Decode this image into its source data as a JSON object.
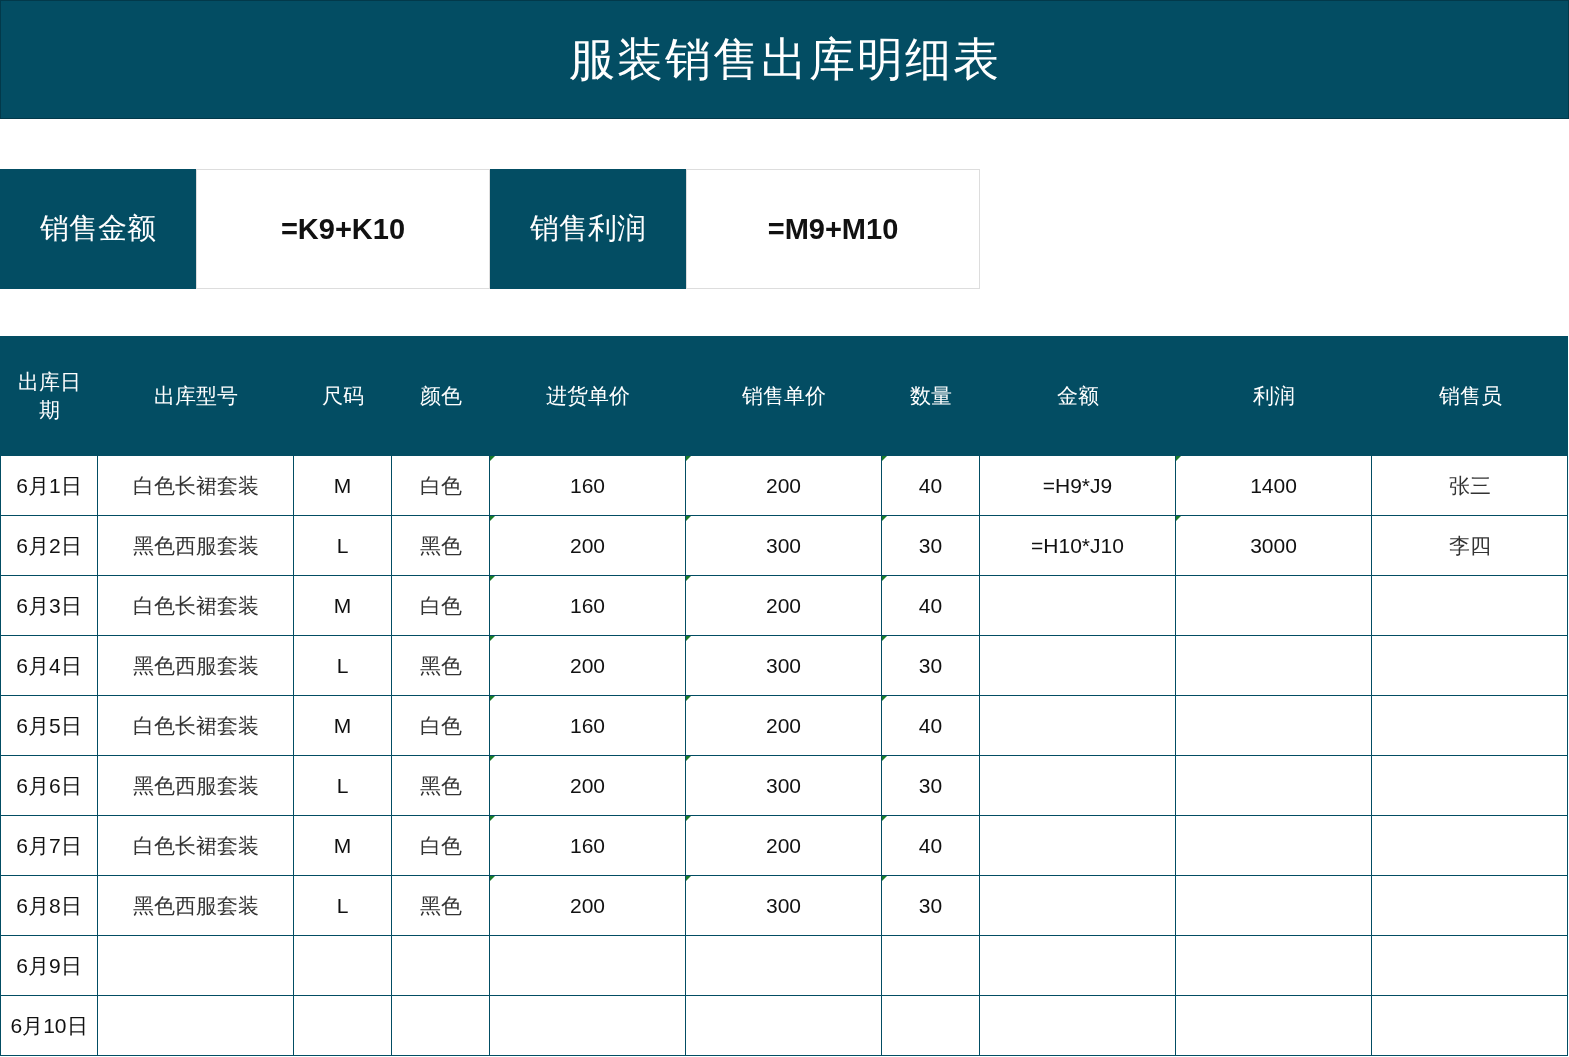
{
  "title": "服装销售出库明细表",
  "summary": [
    {
      "label": "销售金额",
      "value": "=K9+K10"
    },
    {
      "label": "销售利润",
      "value": "=M9+M10"
    }
  ],
  "table": {
    "columns": [
      "出库日期",
      "出库型号",
      "尺码",
      "颜色",
      "进货单价",
      "销售单价",
      "数量",
      "金额",
      "利润",
      "销售员"
    ],
    "rows": [
      [
        {
          "text": "6月1日",
          "flagged": false
        },
        {
          "text": "白色长裙套装",
          "flagged": false
        },
        {
          "text": "M",
          "flagged": false
        },
        {
          "text": "白色",
          "flagged": false
        },
        {
          "text": "160",
          "flagged": true
        },
        {
          "text": "200",
          "flagged": true
        },
        {
          "text": "40",
          "flagged": true
        },
        {
          "text": "=H9*J9",
          "flagged": false
        },
        {
          "text": "1400",
          "flagged": true
        },
        {
          "text": "张三",
          "flagged": false
        }
      ],
      [
        {
          "text": "6月2日",
          "flagged": false
        },
        {
          "text": "黑色西服套装",
          "flagged": false
        },
        {
          "text": "L",
          "flagged": false
        },
        {
          "text": "黑色",
          "flagged": false
        },
        {
          "text": "200",
          "flagged": true
        },
        {
          "text": "300",
          "flagged": true
        },
        {
          "text": "30",
          "flagged": true
        },
        {
          "text": "=H10*J10",
          "flagged": false
        },
        {
          "text": "3000",
          "flagged": true
        },
        {
          "text": "李四",
          "flagged": false
        }
      ],
      [
        {
          "text": "6月3日",
          "flagged": false
        },
        {
          "text": "白色长裙套装",
          "flagged": false
        },
        {
          "text": "M",
          "flagged": false
        },
        {
          "text": "白色",
          "flagged": false
        },
        {
          "text": "160",
          "flagged": true
        },
        {
          "text": "200",
          "flagged": true
        },
        {
          "text": "40",
          "flagged": true
        }
      ],
      [
        {
          "text": "6月4日",
          "flagged": false
        },
        {
          "text": "黑色西服套装",
          "flagged": false
        },
        {
          "text": "L",
          "flagged": false
        },
        {
          "text": "黑色",
          "flagged": false
        },
        {
          "text": "200",
          "flagged": true
        },
        {
          "text": "300",
          "flagged": true
        },
        {
          "text": "30",
          "flagged": true
        }
      ],
      [
        {
          "text": "6月5日",
          "flagged": false
        },
        {
          "text": "白色长裙套装",
          "flagged": false
        },
        {
          "text": "M",
          "flagged": false
        },
        {
          "text": "白色",
          "flagged": false
        },
        {
          "text": "160",
          "flagged": true
        },
        {
          "text": "200",
          "flagged": true
        },
        {
          "text": "40",
          "flagged": true
        }
      ],
      [
        {
          "text": "6月6日",
          "flagged": false
        },
        {
          "text": "黑色西服套装",
          "flagged": false
        },
        {
          "text": "L",
          "flagged": false
        },
        {
          "text": "黑色",
          "flagged": false
        },
        {
          "text": "200",
          "flagged": true
        },
        {
          "text": "300",
          "flagged": true
        },
        {
          "text": "30",
          "flagged": true
        }
      ],
      [
        {
          "text": "6月7日",
          "flagged": false
        },
        {
          "text": "白色长裙套装",
          "flagged": false
        },
        {
          "text": "M",
          "flagged": false
        },
        {
          "text": "白色",
          "flagged": false
        },
        {
          "text": "160",
          "flagged": true
        },
        {
          "text": "200",
          "flagged": true
        },
        {
          "text": "40",
          "flagged": true
        }
      ],
      [
        {
          "text": "6月8日",
          "flagged": false
        },
        {
          "text": "黑色西服套装",
          "flagged": false
        },
        {
          "text": "L",
          "flagged": false
        },
        {
          "text": "黑色",
          "flagged": false
        },
        {
          "text": "200",
          "flagged": true
        },
        {
          "text": "300",
          "flagged": true
        },
        {
          "text": "30",
          "flagged": true
        }
      ],
      [
        {
          "text": "6月9日",
          "flagged": false
        }
      ],
      [
        {
          "text": "6月10日",
          "flagged": false
        }
      ]
    ]
  }
}
